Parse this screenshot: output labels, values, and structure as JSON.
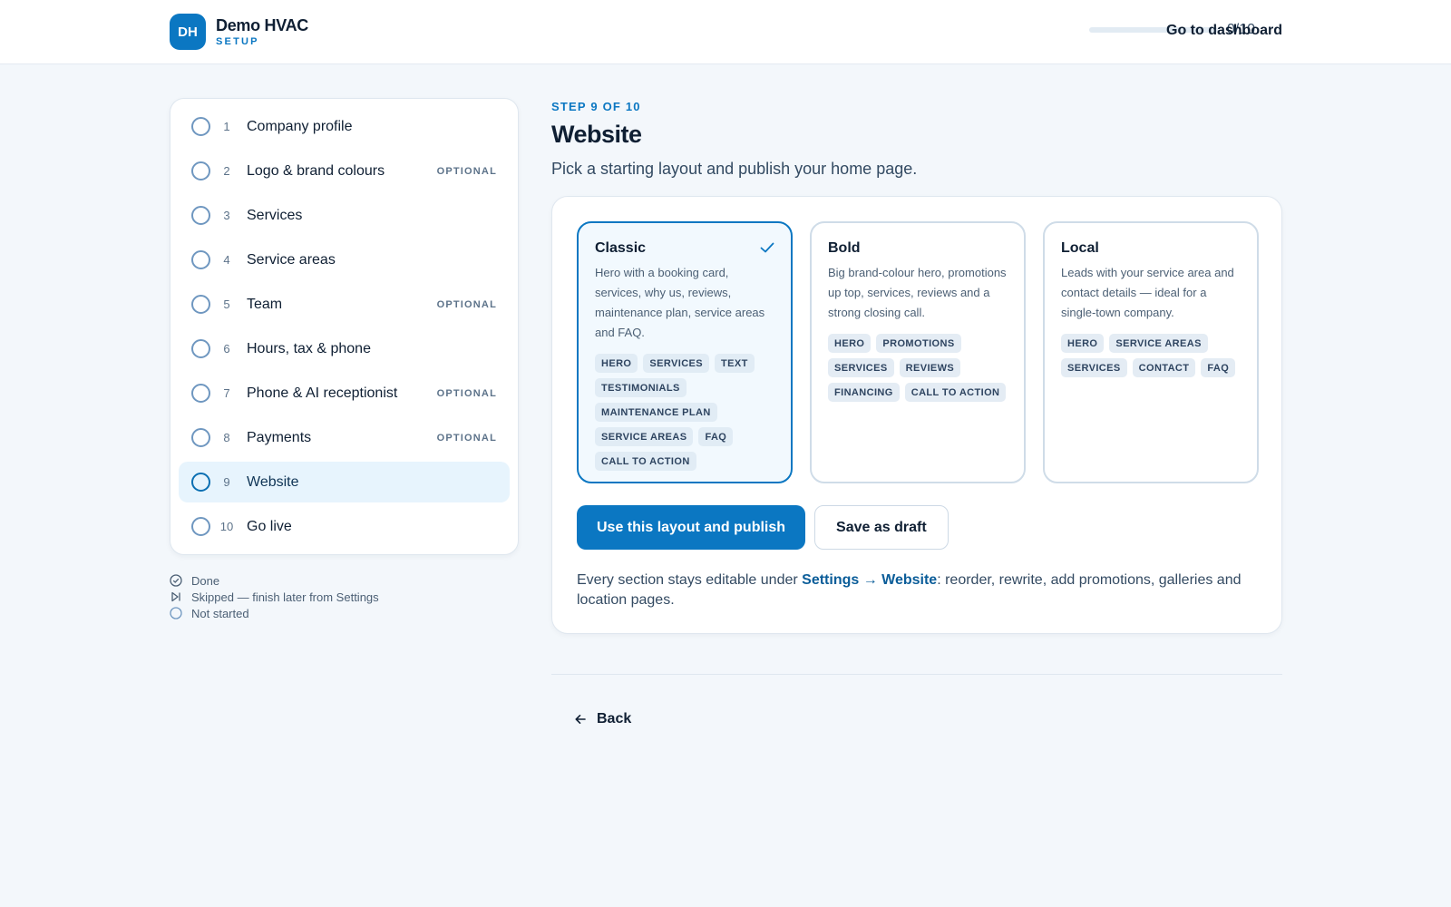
{
  "header": {
    "logo_initials": "DH",
    "company_name": "Demo HVAC",
    "subtitle": "SETUP",
    "progress_fraction": 0,
    "progress_text": "0/10",
    "dashboard_link": "Go to dashboard"
  },
  "steps": [
    {
      "num": "1",
      "label": "Company profile",
      "optional": ""
    },
    {
      "num": "2",
      "label": "Logo & brand colours",
      "optional": "OPTIONAL"
    },
    {
      "num": "3",
      "label": "Services",
      "optional": ""
    },
    {
      "num": "4",
      "label": "Service areas",
      "optional": ""
    },
    {
      "num": "5",
      "label": "Team",
      "optional": "OPTIONAL"
    },
    {
      "num": "6",
      "label": "Hours, tax & phone",
      "optional": ""
    },
    {
      "num": "7",
      "label": "Phone & AI receptionist",
      "optional": "OPTIONAL"
    },
    {
      "num": "8",
      "label": "Payments",
      "optional": "OPTIONAL"
    },
    {
      "num": "9",
      "label": "Website",
      "optional": ""
    },
    {
      "num": "10",
      "label": "Go live",
      "optional": ""
    }
  ],
  "active_step": "9",
  "legend": {
    "done": "Done",
    "skipped": "Skipped — finish later from Settings",
    "not_started": "Not started"
  },
  "main": {
    "eyebrow": "STEP 9 OF 10",
    "title": "Website",
    "subtitle": "Pick a starting layout and publish your home page.",
    "layouts": [
      {
        "name": "Classic",
        "selected": true,
        "description": "Hero with a booking card, services, why us, reviews, maintenance plan, service areas and FAQ.",
        "tags": [
          "HERO",
          "SERVICES",
          "TEXT",
          "TESTIMONIALS",
          "MAINTENANCE PLAN",
          "SERVICE AREAS",
          "FAQ",
          "CALL TO ACTION"
        ]
      },
      {
        "name": "Bold",
        "selected": false,
        "description": "Big brand-colour hero, promotions up top, services, reviews and a strong closing call.",
        "tags": [
          "HERO",
          "PROMOTIONS",
          "SERVICES",
          "REVIEWS",
          "FINANCING",
          "CALL TO ACTION"
        ]
      },
      {
        "name": "Local",
        "selected": false,
        "description": "Leads with your service area and contact details — ideal for a single-town company.",
        "tags": [
          "HERO",
          "SERVICE AREAS",
          "SERVICES",
          "CONTACT",
          "FAQ"
        ]
      }
    ],
    "publish_button": "Use this layout and publish",
    "draft_button": "Save as draft",
    "note_prefix": "Every section stays editable under ",
    "note_link": "Settings → Website",
    "note_suffix": ": reorder, rewrite, add promotions, galleries and location pages.",
    "back_button": "Back"
  },
  "colors": {
    "accent": "#0b77c2",
    "active_step_bg": "#e7f4fd",
    "page_bg": "#f3f7fb"
  }
}
